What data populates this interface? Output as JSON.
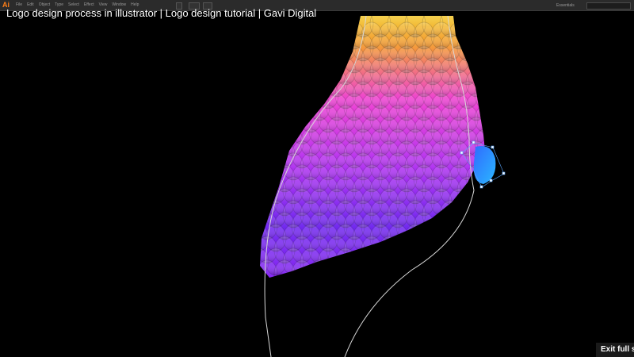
{
  "video": {
    "title": "Logo design process in illustrator | Logo design tutorial | Gavi Digital",
    "exit_fullscreen_label": "Exit full sc"
  },
  "app": {
    "logo": "Ai",
    "menus": [
      "File",
      "Edit",
      "Object",
      "Type",
      "Select",
      "Effect",
      "View",
      "Window",
      "Help"
    ],
    "workspace_label": "Essentials"
  },
  "colors": {
    "background": "#000000",
    "guide_stroke": "#d8d8d8",
    "selection": "#5aa8ff",
    "gradient": [
      "#f3d13a",
      "#f49a2f",
      "#ee3fd2",
      "#b431f0",
      "#6f25ee",
      "#2f6bff"
    ]
  },
  "artwork": {
    "icon": "bird-feathers-icon",
    "description_name": "feather-scale-pattern"
  }
}
